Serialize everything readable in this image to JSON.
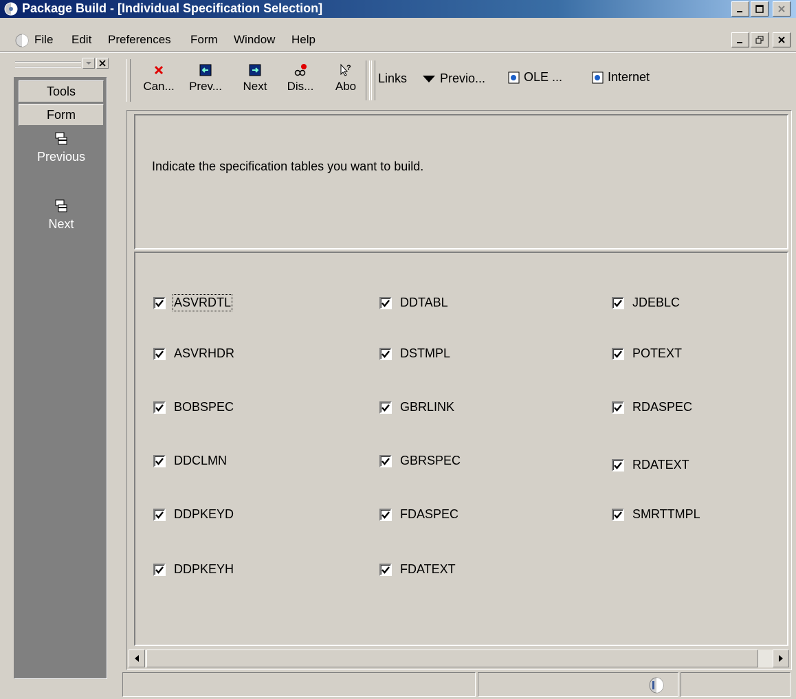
{
  "window": {
    "title": "Package Build - [Individual Specification Selection]"
  },
  "menu": {
    "items": [
      "File",
      "Edit",
      "Preferences",
      "Form",
      "Window",
      "Help"
    ]
  },
  "exit_bar": {
    "tabs": [
      "Tools",
      "Form"
    ],
    "items": [
      "Previous",
      "Next"
    ]
  },
  "toolbar": {
    "buttons": [
      {
        "label": "Can...",
        "icon": "cancel-x-icon"
      },
      {
        "label": "Prev...",
        "icon": "previous-arrow-icon"
      },
      {
        "label": "Next",
        "icon": "next-arrow-icon"
      },
      {
        "label": "Dis...",
        "icon": "display-glasses-icon"
      },
      {
        "label": "Abo",
        "icon": "about-help-icon"
      }
    ],
    "links_label": "Links",
    "link_items": [
      "Previo...",
      "OLE ...",
      "Internet"
    ]
  },
  "header_panel": {
    "instruction": "Indicate the specification tables you want to build."
  },
  "specs": {
    "column1": [
      "ASVRDTL",
      "ASVRHDR",
      "BOBSPEC",
      "DDCLMN",
      "DDPKEYD",
      "DDPKEYH"
    ],
    "column2": [
      "DDTABL",
      "DSTMPL",
      "GBRLINK",
      "GBRSPEC",
      "FDASPEC",
      "FDATEXT"
    ],
    "column3": [
      "JDEBLC",
      "POTEXT",
      "RDASPEC",
      "RDATEXT",
      "SMRTTMPL"
    ],
    "all_checked": true
  },
  "colors": {
    "titlebar_start": "#0a246a",
    "titlebar_end": "#a6caf0",
    "face": "#d4d0c8",
    "exitbar": "#808080"
  }
}
